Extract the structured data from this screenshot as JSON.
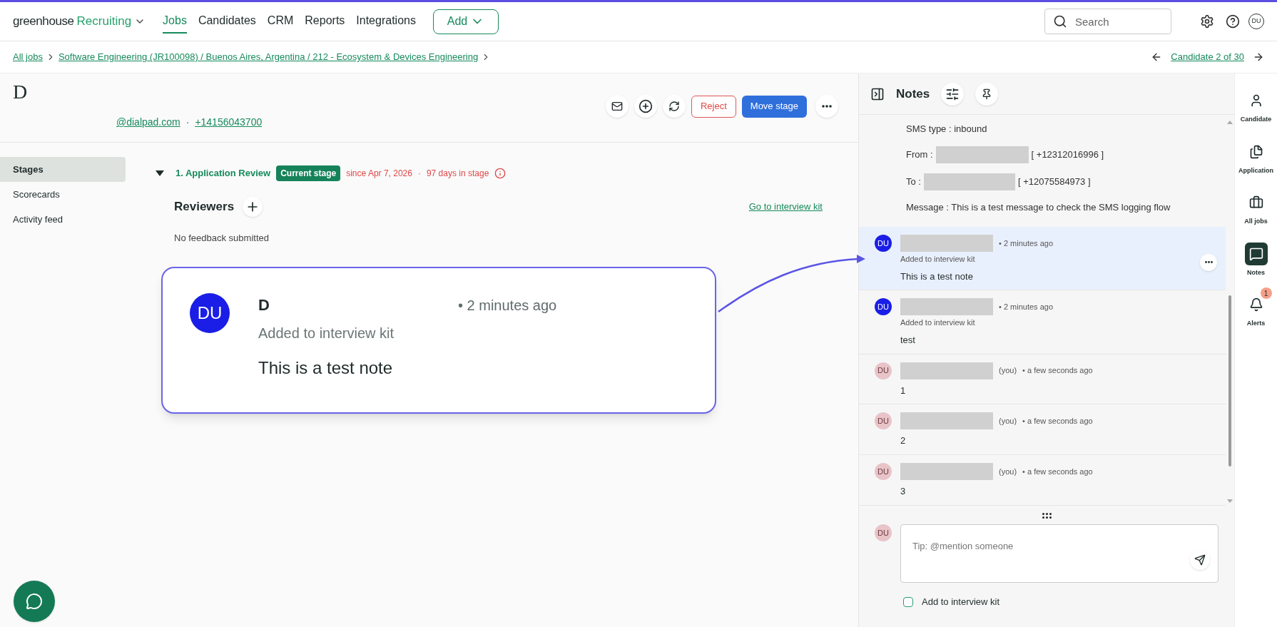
{
  "brand": {
    "name": "greenhouse",
    "product": "Recruiting"
  },
  "nav": [
    {
      "label": "Jobs",
      "selected": true
    },
    {
      "label": "Candidates",
      "selected": false
    },
    {
      "label": "CRM",
      "selected": false
    },
    {
      "label": "Reports",
      "selected": false
    },
    {
      "label": "Integrations",
      "selected": false
    }
  ],
  "add_button": "Add",
  "search": {
    "placeholder": "Search"
  },
  "user_initials": "DU",
  "breadcrumb": [
    "All jobs",
    "Software Engineering (JR100098) / Buenos Aires, Argentina / 212 - Ecosystem & Devices Engineering"
  ],
  "candidate_nav": "Candidate 2 of 30",
  "candidate": {
    "name": "D",
    "email": "@dialpad.com",
    "separator": "·",
    "phone": "+14156043700"
  },
  "actions": {
    "reject": "Reject",
    "move": "Move stage"
  },
  "sidebar": [
    {
      "label": "Stages",
      "selected": true
    },
    {
      "label": "Scorecards",
      "selected": false
    },
    {
      "label": "Activity feed",
      "selected": false
    }
  ],
  "stage": {
    "expanded": true,
    "name": "1. Application Review",
    "badge": "Current stage",
    "since": "since Apr 7, 2026",
    "separator": "·",
    "days": "97 days in stage"
  },
  "reviewers": {
    "title": "Reviewers",
    "link": "Go to interview kit",
    "empty": "No feedback submitted"
  },
  "callout": {
    "initials": "DU",
    "color": "#1a1ee6",
    "author": "D",
    "time": "• 2 minutes ago",
    "subtitle": "Added to interview kit",
    "body": "This is a test note"
  },
  "notes": {
    "title": "Notes",
    "sms": {
      "type": "SMS type : inbound",
      "from_label": "From :",
      "from_number": "[ +12312016996 ]",
      "to_label": "To :",
      "to_number": "[ +12075584973 ]",
      "message": "Message : This is a test message to check the SMS logging flow"
    },
    "items": [
      {
        "initials": "DU",
        "color": "#1a1ee6",
        "selected": true,
        "time": "• 2 minutes ago",
        "subtitle": "Added to interview kit",
        "body": "This is a test note"
      },
      {
        "initials": "DU",
        "color": "#1a1ee6",
        "selected": false,
        "time": "• 2 minutes ago",
        "subtitle": "Added to interview kit",
        "body": "test"
      },
      {
        "initials": "DU",
        "color": "#e8c4c8",
        "selected": false,
        "you_label": "(you)",
        "time": "• a few seconds ago",
        "body": "1"
      },
      {
        "initials": "DU",
        "color": "#e8c4c8",
        "selected": false,
        "you_label": "(you)",
        "time": "• a few seconds ago",
        "body": "2"
      },
      {
        "initials": "DU",
        "color": "#e8c4c8",
        "selected": false,
        "you_label": "(you)",
        "time": "• a few seconds ago",
        "body": "3"
      }
    ],
    "composer": {
      "initials": "DU",
      "color": "#e8c4c8",
      "placeholder": "Tip: @mention someone",
      "checkbox": {
        "label": "Add to interview kit",
        "checked": false
      }
    }
  },
  "rail": [
    {
      "kind": "candidate",
      "label": "Candidate",
      "selected": false
    },
    {
      "kind": "application",
      "label": "Application",
      "selected": false
    },
    {
      "kind": "jobs",
      "label": "All jobs",
      "selected": false
    },
    {
      "kind": "notes",
      "label": "Notes",
      "selected": true
    },
    {
      "kind": "alerts",
      "label": "Alerts",
      "selected": false,
      "badge": "1"
    }
  ]
}
